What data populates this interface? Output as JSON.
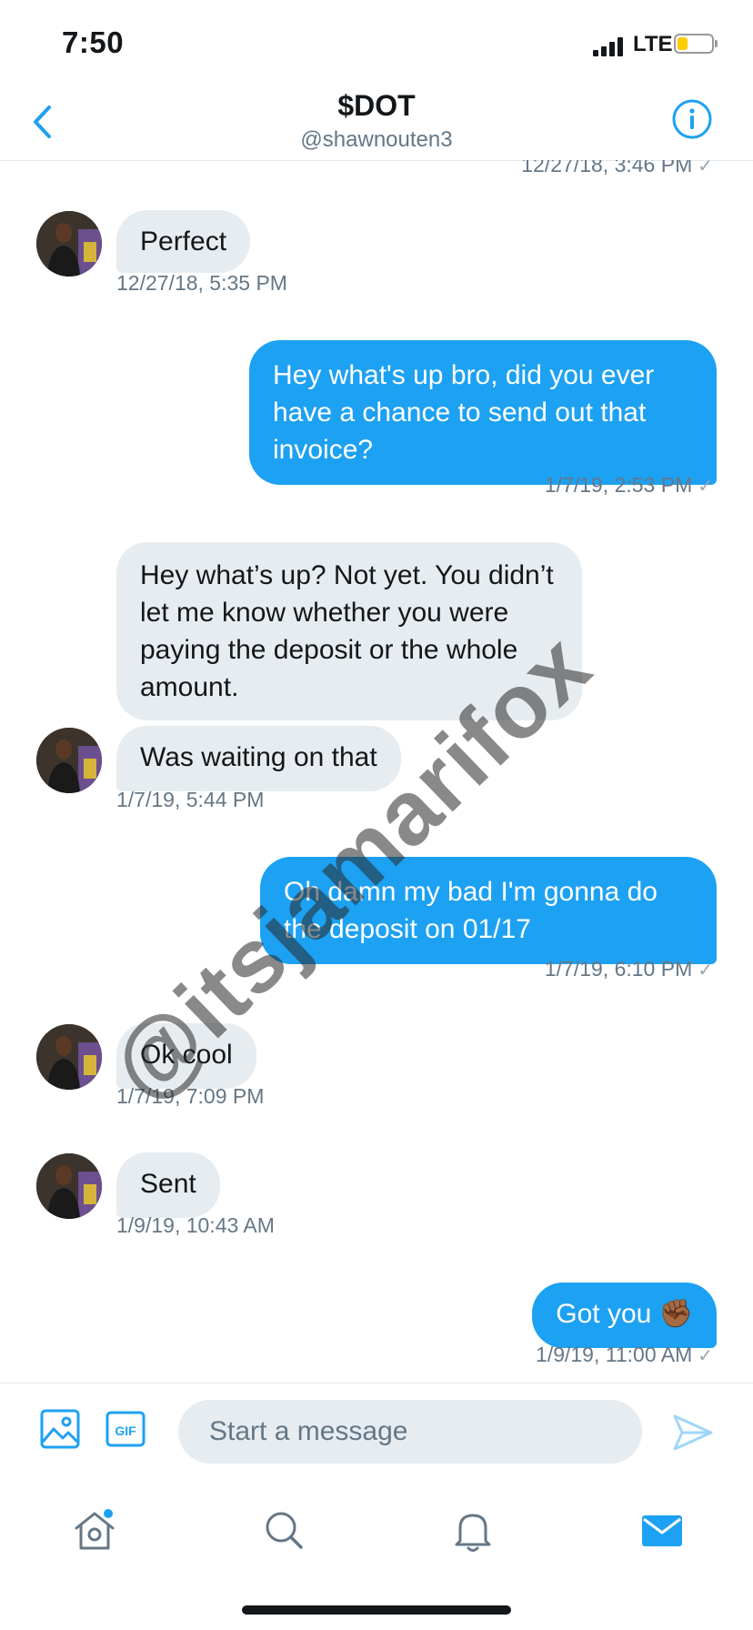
{
  "status_bar": {
    "time": "7:50",
    "network": "LTE",
    "battery_level": 0.3
  },
  "header": {
    "title": "$DOT",
    "handle": "@shawnouten3"
  },
  "conversation": {
    "top_timestamp": "12/27/18, 3:46 PM",
    "messages": [
      {
        "sender": "them",
        "text": "Perfect",
        "timestamp": "12/27/18, 5:35 PM"
      },
      {
        "sender": "me",
        "text": "Hey what's up bro, did you ever have a chance to send out that invoice?",
        "timestamp": "1/7/19, 2:53 PM"
      },
      {
        "sender": "them",
        "text": "Hey what’s up? Not yet. You didn’t let me know whether you were paying the deposit or the whole amount."
      },
      {
        "sender": "them",
        "text": "Was waiting on that",
        "timestamp": "1/7/19, 5:44 PM"
      },
      {
        "sender": "me",
        "text": "Oh damn my bad I'm gonna do the deposit on 01/17",
        "timestamp": "1/7/19, 6:10 PM"
      },
      {
        "sender": "them",
        "text": "Ok cool",
        "timestamp": "1/7/19, 7:09 PM"
      },
      {
        "sender": "them",
        "text": "Sent",
        "timestamp": "1/9/19, 10:43 AM"
      },
      {
        "sender": "me",
        "text": "Got you ✊🏾",
        "timestamp": "1/9/19, 11:00 AM"
      }
    ],
    "read_check": "✓"
  },
  "watermark": "@itsjamarifox",
  "composer": {
    "placeholder": "Start a message",
    "gif_label": "GIF"
  },
  "icons": {
    "back": "chevron-left-icon",
    "info": "info-icon",
    "media": "image-icon",
    "gif": "gif-icon",
    "send": "send-icon",
    "tabs": [
      "home-icon",
      "search-icon",
      "notifications-icon",
      "messages-icon"
    ]
  },
  "colors": {
    "accent": "#1da1f2",
    "incoming_bubble": "#e6ecf0",
    "secondary_text": "#657786"
  }
}
